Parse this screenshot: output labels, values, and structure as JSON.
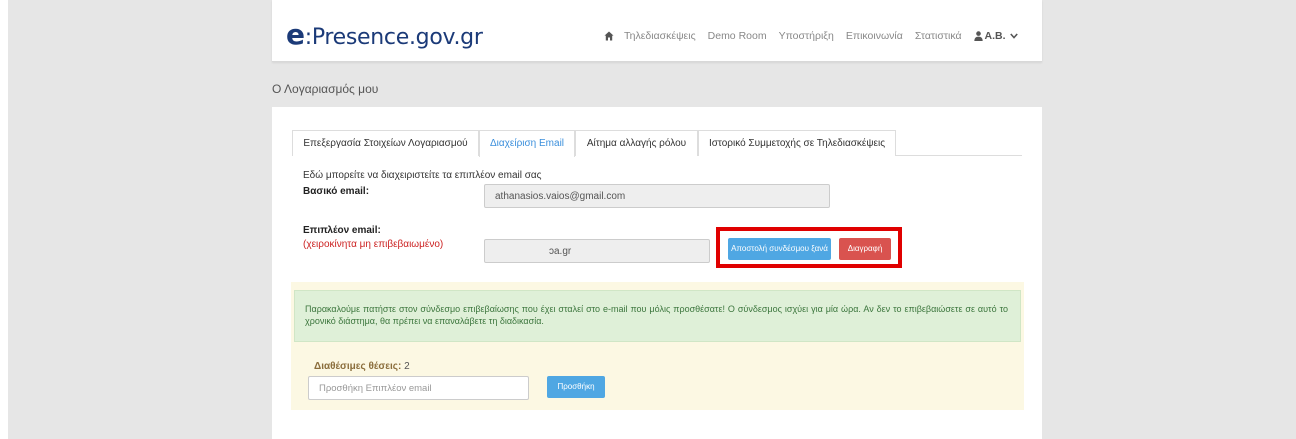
{
  "navbar": {
    "brand_e": "e",
    "brand_rest": ":Presence.gov.gr",
    "items": {
      "conferences": "Τηλεδιασκέψεις",
      "demo_room": "Demo Room",
      "support": "Υποστήριξη",
      "contact": "Επικοινωνία",
      "statistics": "Στατιστικά",
      "user": "Α.Β."
    }
  },
  "page_title": "Ο Λογαριασμός μου",
  "tabs": [
    {
      "label": "Επεξεργασία Στοιχείων Λογαριασμού"
    },
    {
      "label": "Διαχείριση Email"
    },
    {
      "label": "Αίτημα αλλαγής ρόλου"
    },
    {
      "label": "Ιστορικό Συμμετοχής σε Τηλεδιασκέψεις"
    }
  ],
  "email_mgmt": {
    "intro": "Εδώ μπορείτε να διαχειριστείτε τα επιπλέον email σας",
    "primary_label": "Βασικό email:",
    "primary_value": "athanasios.vaios@gmail.com",
    "extra_label": "Επιπλέον email:",
    "extra_status": "(χειροκίνητα μη επιβεβαιωμένο)",
    "extra_value": "ɔa.gr",
    "resend_label": "Αποστολή συνδέσμου ξανά",
    "delete_label": "Διαγραφή"
  },
  "alert": {
    "text": "Παρακαλούμε πατήστε στον σύνδεσμο επιβεβαίωσης που έχει σταλεί στο e-mail που μόλις προσθέσατε! Ο σύνδεσμος ισχύει για μία ώρα. Αν δεν το επιβεβαιώσετε σε αυτό το χρονικό διάστημα, θα πρέπει να επαναλάβετε τη διαδικασία."
  },
  "add_email": {
    "slots_label": "Διαθέσιμες θέσεις:",
    "slots_value": "2",
    "placeholder": "Προσθήκη Επιπλέον email",
    "add_label": "Προσθήκη"
  },
  "colors": {
    "brand": "#1b3a78",
    "link_active": "#3b8fdc",
    "primary_button": "#4fa7e3",
    "danger_button": "#d9534f",
    "highlight": "#e00000",
    "success_bg": "#dff0d8",
    "warning_bg": "#fcf8e3"
  }
}
